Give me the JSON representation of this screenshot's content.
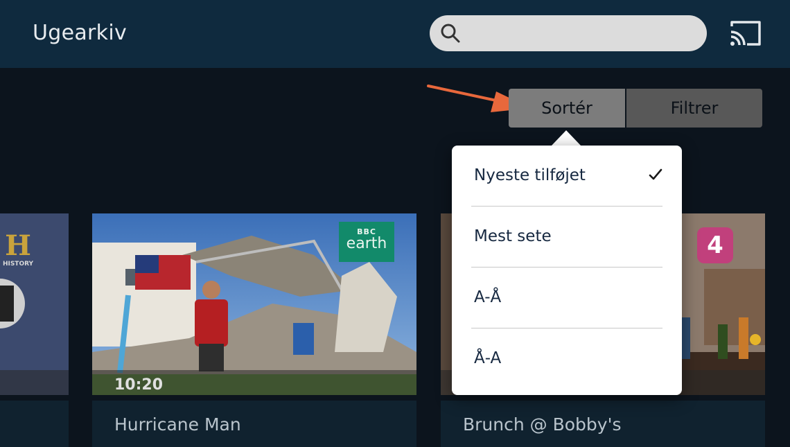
{
  "header": {
    "title": "Ugearkiv",
    "search_placeholder": "",
    "search_icon": "search-icon",
    "cast_icon": "cast-icon"
  },
  "toolbar": {
    "sort_label": "Sortér",
    "filter_label": "Filtrer"
  },
  "sort_menu": {
    "options": [
      {
        "label": "Nyeste tilføjet",
        "selected": true
      },
      {
        "label": "Mest sete",
        "selected": false
      },
      {
        "label": "A-Å",
        "selected": false
      },
      {
        "label": "Å-A",
        "selected": false
      }
    ]
  },
  "cards": [
    {
      "title": "",
      "channel": "HISTORY"
    },
    {
      "title": "Hurricane Man",
      "duration": "10:20",
      "channel": "BBC earth",
      "channel_top": "BBC",
      "channel_bottom": "earth"
    },
    {
      "title": "Brunch @ Bobby's",
      "channel": "4"
    }
  ],
  "colors": {
    "header_bg": "#0f2a3e",
    "page_bg": "#0c141d",
    "annotation_arrow": "#e8683c",
    "sort_active": "#7c7c7c",
    "filter_inactive": "#585858"
  }
}
